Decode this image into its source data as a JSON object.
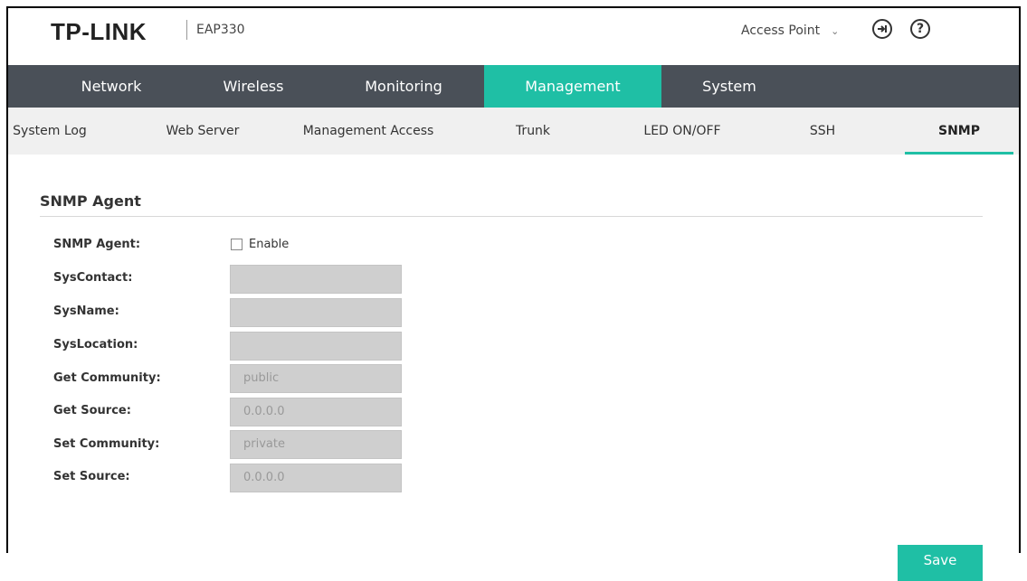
{
  "header": {
    "brand": "TP-LINK",
    "model": "EAP330",
    "mode": "Access Point",
    "logout_icon": "logout-icon",
    "help_symbol": "?"
  },
  "main_nav": {
    "tabs": [
      {
        "label": "Network"
      },
      {
        "label": "Wireless"
      },
      {
        "label": "Monitoring"
      },
      {
        "label": "Management",
        "active": true
      },
      {
        "label": "System"
      }
    ]
  },
  "sub_nav": {
    "tabs": [
      {
        "label": "System Log"
      },
      {
        "label": "Web Server"
      },
      {
        "label": "Management Access"
      },
      {
        "label": "Trunk"
      },
      {
        "label": "LED ON/OFF"
      },
      {
        "label": "SSH"
      },
      {
        "label": "SNMP",
        "active": true
      }
    ]
  },
  "section": {
    "title": "SNMP Agent"
  },
  "form": {
    "snmp_agent_label": "SNMP Agent:",
    "enable_label": "Enable",
    "enable_checked": false,
    "fields": [
      {
        "label": "SysContact:",
        "value": ""
      },
      {
        "label": "SysName:",
        "value": ""
      },
      {
        "label": "SysLocation:",
        "value": ""
      },
      {
        "label": "Get Community:",
        "value": "public"
      },
      {
        "label": "Get Source:",
        "value": "0.0.0.0"
      },
      {
        "label": "Set Community:",
        "value": "private"
      },
      {
        "label": "Set Source:",
        "value": "0.0.0.0"
      }
    ]
  },
  "actions": {
    "save_label": "Save"
  },
  "colors": {
    "accent": "#1fbfa5",
    "nav_bg": "#4a5058",
    "subnav_bg": "#f0f0f0",
    "input_disabled_bg": "#cfcfcf"
  }
}
